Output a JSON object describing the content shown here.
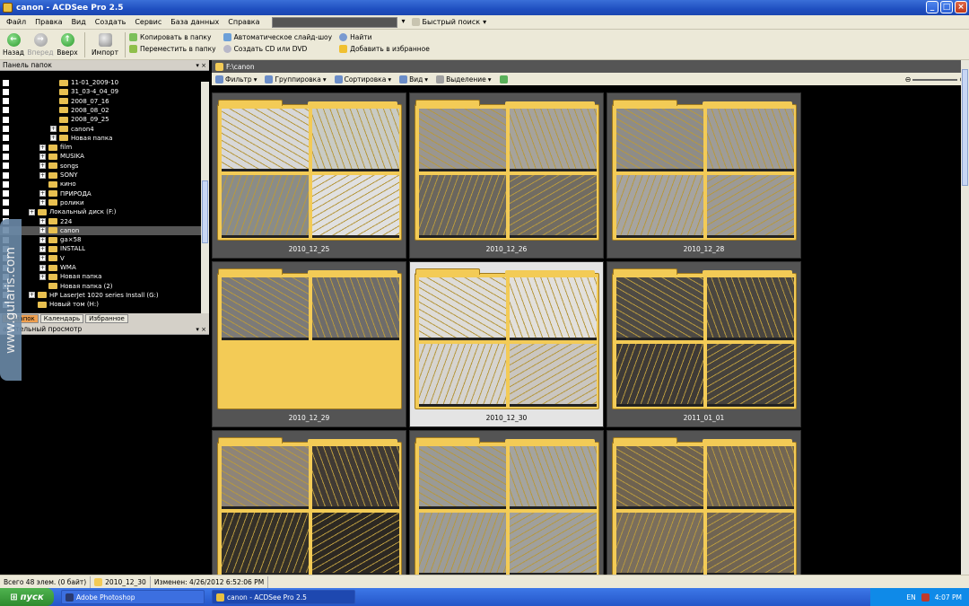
{
  "window": {
    "title": "canon - ACDSee Pro 2.5"
  },
  "menu": [
    "Файл",
    "Правка",
    "Вид",
    "Создать",
    "Сервис",
    "База данных",
    "Справка"
  ],
  "quick_search": "Быстрый поиск",
  "toolbar": {
    "back": "Назад",
    "forward": "Вперед",
    "up": "Вверх",
    "import": "Импорт",
    "copy_to_folder": "Копировать в папку",
    "move_to_folder": "Переместить в папку",
    "slideshow": "Автоматическое слайд-шоу",
    "create_cd": "Создать CD или DVD",
    "find": "Найти",
    "add_favorites": "Добавить в избранное"
  },
  "left_panel": {
    "title": "Панель папок",
    "tree": [
      {
        "label": "11-01_2009-10",
        "level": 3
      },
      {
        "label": "31_03-4_04_09",
        "level": 3
      },
      {
        "label": "2008_07_16",
        "level": 3
      },
      {
        "label": "2008_08_02",
        "level": 3
      },
      {
        "label": "2008_09_25",
        "level": 3
      },
      {
        "label": "canon4",
        "level": 3,
        "plus": true
      },
      {
        "label": "Новая папка",
        "level": 3,
        "plus": true
      },
      {
        "label": "film",
        "level": 2,
        "plus": true
      },
      {
        "label": "MUSIKA",
        "level": 2,
        "plus": true
      },
      {
        "label": "songs",
        "level": 2,
        "plus": true
      },
      {
        "label": "SONY",
        "level": 2,
        "plus": true
      },
      {
        "label": "кино",
        "level": 2
      },
      {
        "label": "ПРИРОДА",
        "level": 2,
        "plus": true
      },
      {
        "label": "ролики",
        "level": 2,
        "plus": true
      },
      {
        "label": "Локальный диск (F:)",
        "level": 1,
        "plus": true
      },
      {
        "label": "224",
        "level": 2,
        "plus": true
      },
      {
        "label": "canon",
        "level": 2,
        "plus": true,
        "selected": true
      },
      {
        "label": "ga×58",
        "level": 2,
        "plus": true
      },
      {
        "label": "INSTALL",
        "level": 2,
        "plus": true
      },
      {
        "label": "V",
        "level": 2,
        "plus": true
      },
      {
        "label": "WMA",
        "level": 2,
        "plus": true
      },
      {
        "label": "Новая папка",
        "level": 2,
        "plus": true
      },
      {
        "label": "Новая папка (2)",
        "level": 2
      },
      {
        "label": "HP LaserJet 1020 series Install (G:)",
        "level": 1,
        "plus": true
      },
      {
        "label": "Новый том (H:)",
        "level": 1
      }
    ],
    "tabs": [
      "ль папок",
      "Календарь",
      "Избранное"
    ],
    "preview_title": "арительный просмотр"
  },
  "watermark": "www.gularis.com",
  "content": {
    "path": "F:\\canon",
    "filter": "Фильтр",
    "group": "Группировка",
    "sort": "Сортировка",
    "view": "Вид",
    "select": "Выделение",
    "tiles": [
      {
        "name": "2010_12_25",
        "tone": [
          "#d8d8d8",
          "#c9cbc4",
          "#8a8c88",
          "#e0e0e0"
        ]
      },
      {
        "name": "2010_12_26",
        "tone": [
          "#9a9690",
          "#a6a39c",
          "#6a665e",
          "#716c62"
        ]
      },
      {
        "name": "2010_12_28",
        "tone": [
          "#8e8c88",
          "#9e9c98",
          "#a6a4a0",
          "#9c9a96"
        ]
      },
      {
        "name": "2010_12_29",
        "tone": [
          "#7c7a78",
          "#6e6c6a",
          "",
          ""
        ]
      },
      {
        "name": "2010_12_30",
        "tone": [
          "#dedcd8",
          "#e2e0dc",
          "#d6d4d0",
          "#cac6c0"
        ],
        "selected": true
      },
      {
        "name": "2011_01_01",
        "tone": [
          "#4e4a44",
          "#4a4640",
          "#3e3a36",
          "#46423c"
        ]
      },
      {
        "name": "",
        "tone": [
          "#8e8478",
          "#403a34",
          "#343028",
          "#2c2822"
        ]
      },
      {
        "name": "",
        "tone": [
          "#9a9a96",
          "#a4a4a0",
          "#9c9c98",
          "#a0a09c"
        ]
      },
      {
        "name": "",
        "tone": [
          "#6e6250",
          "#726654",
          "#7a6e5c",
          "#706452"
        ]
      }
    ]
  },
  "status": {
    "total": "Всего 48 элем. (0 байт)",
    "folder": "2010_12_30",
    "modified": "Изменен: 4/26/2012 6:52:06 PM"
  },
  "taskbar": {
    "start": "пуск",
    "tasks": [
      "Adobe Photoshop",
      "canon - ACDSee Pro 2.5"
    ],
    "lang": "EN",
    "time": "4:07 PM"
  }
}
